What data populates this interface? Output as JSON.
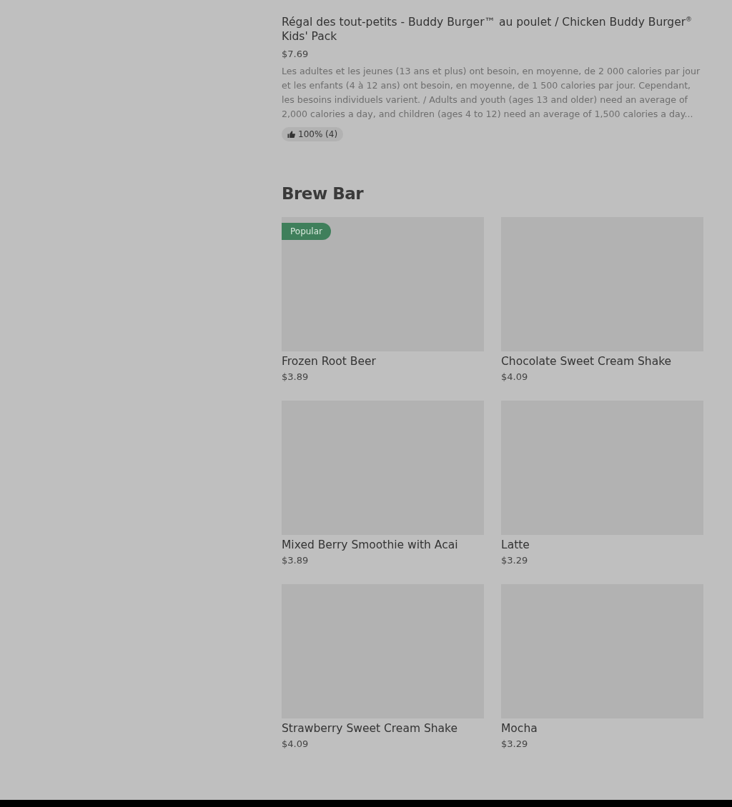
{
  "featured_item": {
    "name": "Régal des tout-petits - Buddy Burger™ au poulet / Chicken Buddy Burger$^{®}$ Kids' Pack",
    "price": "$7.69",
    "description": "Les adultes et les jeunes (13 ans et plus) ont besoin, en moyenne, de 2 000 calories par jour et les enfants (4 à 12 ans) ont besoin, en moyenne, de 1 500 calories par jour. Cependant, les besoins individuels varient. / Adults and youth (ages 13 and older) need an average of 2,000 calories a day, and children (ages 4 to 12) need an average of 1,500 calories a day...",
    "rating": "100% (4)"
  },
  "section": {
    "title": "Brew Bar",
    "items": [
      {
        "name": "Frozen Root Beer",
        "price": "$3.89",
        "badge": "Popular"
      },
      {
        "name": "Chocolate Sweet Cream Shake",
        "price": "$4.09"
      },
      {
        "name": "Mixed Berry Smoothie with Acai",
        "price": "$3.89"
      },
      {
        "name": "Latte",
        "price": "$3.29"
      },
      {
        "name": "Strawberry Sweet Cream Shake",
        "price": "$4.09"
      },
      {
        "name": "Mocha",
        "price": "$3.29"
      }
    ]
  }
}
